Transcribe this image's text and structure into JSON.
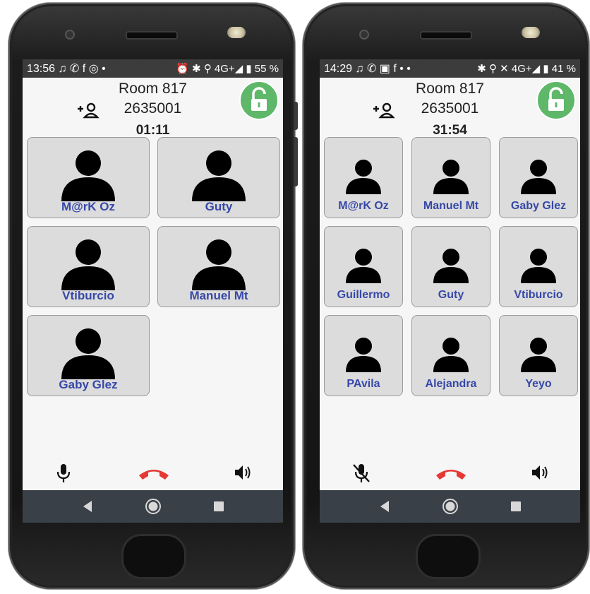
{
  "phones": [
    {
      "status": {
        "time": "13:56",
        "icons": "♫ ✆ f ◎ •",
        "right": "⏰ ✱ ⚲ 4G+◢ ▮ 55 %"
      },
      "call": {
        "room": "Room 817",
        "number": "2635001",
        "timer": "01:11"
      },
      "participants": [
        "M@rK Oz",
        "Guty",
        "Vtiburcio",
        "Manuel Mt",
        "Gaby Glez"
      ],
      "mic_state": "on"
    },
    {
      "status": {
        "time": "14:29",
        "icons": "♫ ✆ ▣ f • •",
        "right": "✱ ⚲ ✕ 4G+◢ ▮ 41 %"
      },
      "call": {
        "room": "Room 817",
        "number": "2635001",
        "timer": "31:54"
      },
      "participants": [
        "M@rK Oz",
        "Manuel Mt",
        "Gaby Glez",
        "Guillermo",
        "Guty",
        "Vtiburcio",
        "PAvila",
        "Alejandra",
        "Yeyo"
      ],
      "mic_state": "muted"
    }
  ],
  "icons": {
    "add_person": "add-person-icon",
    "lock": "unlock-icon",
    "mic": "microphone-icon",
    "mic_muted": "microphone-muted-icon",
    "hangup": "hang-up-icon",
    "speaker": "speaker-icon",
    "back": "back-icon",
    "home": "home-icon",
    "recents": "recents-icon"
  },
  "colors": {
    "accent": "#5fb86a",
    "hangup": "#e53935",
    "name": "#3648a8",
    "tile": "#dcdcdc"
  }
}
